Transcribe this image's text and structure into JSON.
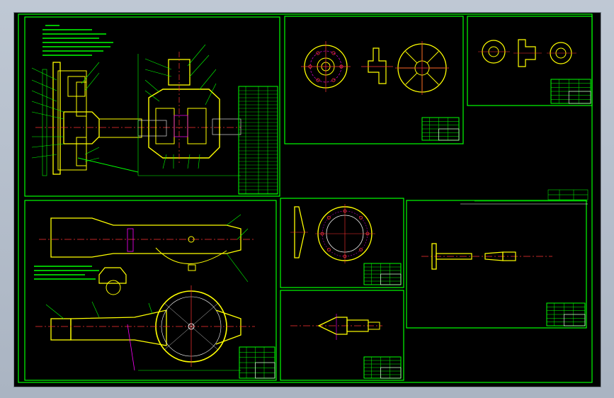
{
  "window": {
    "title": ""
  },
  "drawing": {
    "background": "#000000",
    "colors": {
      "frame": "#00ff00",
      "outline": "#ffff00",
      "center": "#ff3333",
      "white": "#ffffff",
      "accent": "#ff00ff"
    },
    "sheets": [
      {
        "id": "assembly-section",
        "label": ""
      },
      {
        "id": "flange-part",
        "label": ""
      },
      {
        "id": "small-part",
        "label": ""
      },
      {
        "id": "housing-assembly",
        "label": ""
      },
      {
        "id": "gear-part",
        "label": ""
      },
      {
        "id": "pinion-part",
        "label": ""
      },
      {
        "id": "axle-shaft-part",
        "label": ""
      }
    ]
  }
}
